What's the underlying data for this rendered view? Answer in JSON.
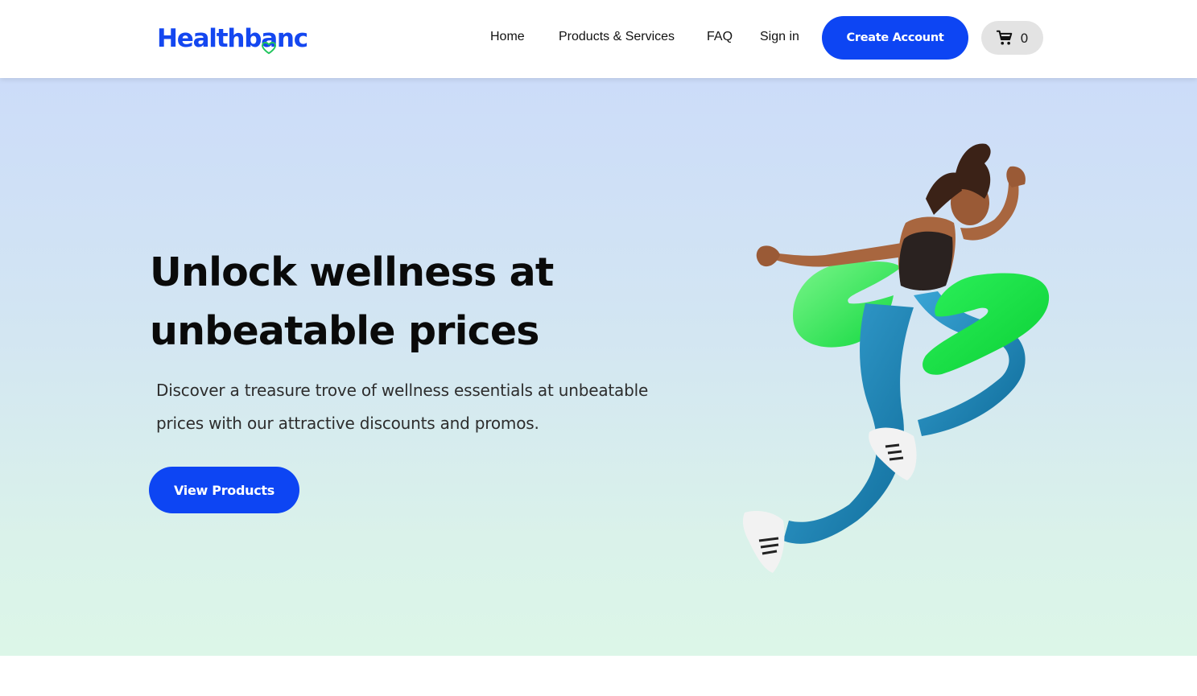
{
  "header": {
    "logo_text_part1": "Healthb",
    "logo_text_part2": "anc",
    "logo_color": "#1447f0",
    "nav": [
      {
        "label": "Home"
      },
      {
        "label": "Products & Services"
      },
      {
        "label": "FAQ"
      },
      {
        "label": "Sign in"
      }
    ],
    "create_account_label": "Create Account",
    "cart": {
      "icon": "cart-icon",
      "count": "0"
    },
    "accent_color": "#0d45f3"
  },
  "hero": {
    "title_line1": "Unlock wellness at",
    "title_line2": "unbeatable prices",
    "subtitle_line1": "Discover a treasure trove of wellness essentials at unbeatable",
    "subtitle_line2": "prices with our attractive discounts and promos.",
    "cta_label": "View Products",
    "image": "runner-athlete-illustration",
    "decor_color": "#1ee64a"
  }
}
